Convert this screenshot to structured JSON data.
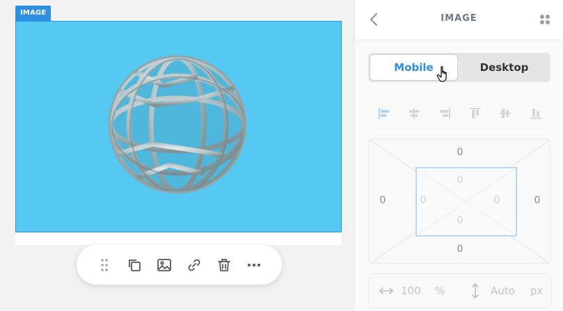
{
  "canvas": {
    "image_tag": "IMAGE",
    "colors": {
      "selection": "#2d8fe0",
      "image_background": "#55c9f1"
    },
    "toolbar": {
      "items": [
        {
          "name": "drag-handle",
          "icon": "grip-dots-icon"
        },
        {
          "name": "duplicate",
          "icon": "copy-icon"
        },
        {
          "name": "replace-image",
          "icon": "image-icon"
        },
        {
          "name": "link",
          "icon": "link-icon"
        },
        {
          "name": "delete",
          "icon": "trash-icon"
        },
        {
          "name": "more",
          "icon": "ellipsis-icon"
        }
      ]
    }
  },
  "panel": {
    "title": "IMAGE",
    "back_icon": "chevron-left-icon",
    "grid_icon": "dots-grid-icon",
    "device_toggle": {
      "mobile_label": "Mobile",
      "desktop_label": "Desktop",
      "selected": "Mobile"
    },
    "alignment": {
      "icons": [
        "align-left-icon",
        "align-center-h-icon",
        "align-right-icon",
        "align-top-icon",
        "align-middle-v-icon",
        "align-bottom-icon"
      ]
    },
    "spacing": {
      "margin_top": "0",
      "margin_right": "0",
      "margin_bottom": "0",
      "margin_left": "0",
      "padding_top": "0",
      "padding_right": "0",
      "padding_bottom": "0",
      "padding_left": "0"
    },
    "size": {
      "width_value": "100",
      "width_unit": "%",
      "height_value": "Auto",
      "height_unit": "px"
    }
  }
}
